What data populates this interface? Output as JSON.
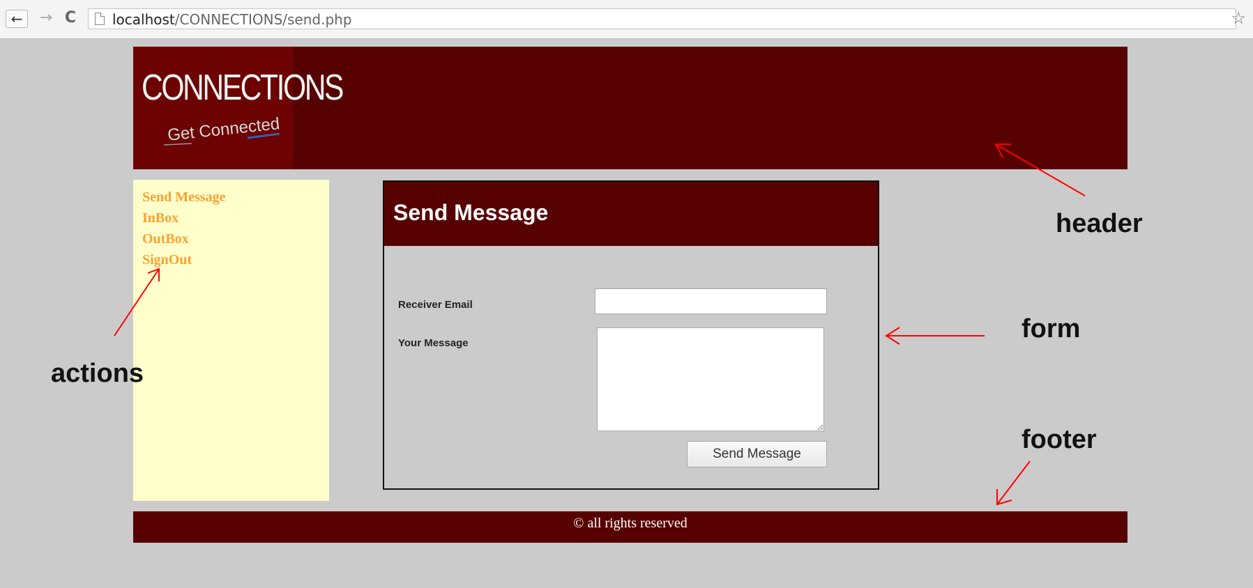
{
  "browser": {
    "back_glyph": "←",
    "forward_glyph": "→",
    "reload_glyph": "C",
    "url_host": "localhost",
    "url_path": "/CONNECTIONS/send.php",
    "star_glyph": "☆"
  },
  "header": {
    "logo_title": "CONNECTIONS",
    "logo_tagline": "Get Connected"
  },
  "sidebar": {
    "items": [
      {
        "label": "Send Message"
      },
      {
        "label": "InBox"
      },
      {
        "label": "OutBox"
      },
      {
        "label": "SignOut"
      }
    ]
  },
  "form": {
    "title": "Send Message",
    "receiver_label": "Receiver Email",
    "receiver_value": "",
    "message_label": "Your Message",
    "message_value": "",
    "submit_label": "Send Message"
  },
  "footer": {
    "text": "© all rights reserved"
  },
  "annotations": {
    "header": "header",
    "form": "form",
    "footer": "footer",
    "actions": "actions",
    "arrow_color": "#ff0000"
  },
  "colors": {
    "maroon": "#570001",
    "sidebar_bg": "#ffffcc",
    "action_link": "#f9a230",
    "page_bg": "#cbcbcb"
  }
}
